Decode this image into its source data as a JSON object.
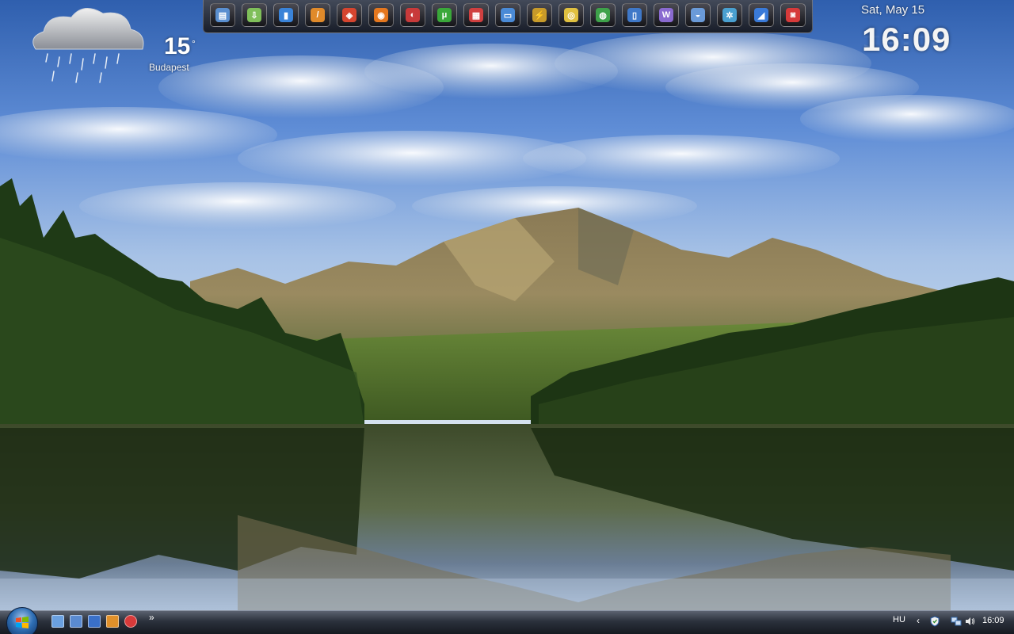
{
  "weather": {
    "temperature": "15",
    "unit": "°",
    "city": "Budapest",
    "condition_icon": "rain-cloud-icon"
  },
  "dock": {
    "icons": [
      {
        "name": "computer-icon",
        "glyph": "▤",
        "color": "#5a8fd0"
      },
      {
        "name": "downloader-icon",
        "glyph": "⇩",
        "color": "#7fbf5a"
      },
      {
        "name": "blue-app-icon",
        "glyph": "▮",
        "color": "#3a83d8"
      },
      {
        "name": "flash-tool-icon",
        "glyph": "/",
        "color": "#e08a2a"
      },
      {
        "name": "photo-app-icon",
        "glyph": "◈",
        "color": "#d6452f"
      },
      {
        "name": "firefox-icon",
        "glyph": "◉",
        "color": "#e5771e"
      },
      {
        "name": "security-app-icon",
        "glyph": "◐",
        "color": "#c83a3a"
      },
      {
        "name": "utorrent-icon",
        "glyph": "μ",
        "color": "#3aa83a"
      },
      {
        "name": "calendar-icon",
        "glyph": "▦",
        "color": "#d04040"
      },
      {
        "name": "window-app-icon",
        "glyph": "▭",
        "color": "#4a8ad6"
      },
      {
        "name": "winamp-icon",
        "glyph": "⚡",
        "color": "#c79a2a"
      },
      {
        "name": "disc-burner-icon",
        "glyph": "◎",
        "color": "#e0c040"
      },
      {
        "name": "chrome-icon",
        "glyph": "◍",
        "color": "#3ea24a"
      },
      {
        "name": "phone-icon",
        "glyph": "▯",
        "color": "#3f78c8"
      },
      {
        "name": "wiki-icon",
        "glyph": "W",
        "color": "#8a6ad0"
      },
      {
        "name": "disc-drive-icon",
        "glyph": "◒",
        "color": "#6a9ad8"
      },
      {
        "name": "settings-gears-icon",
        "glyph": "✲",
        "color": "#4aa0d0"
      },
      {
        "name": "satellite-icon",
        "glyph": "◢",
        "color": "#3a7ad8"
      },
      {
        "name": "robot-icon",
        "glyph": "◙",
        "color": "#d63a3a"
      }
    ]
  },
  "clock": {
    "date": "Sat, May 15",
    "time": "16:09"
  },
  "taskbar": {
    "start_label": "Start",
    "quick_launch": [
      {
        "name": "show-desktop-icon",
        "color": "#6aa0e0"
      },
      {
        "name": "switch-windows-icon",
        "color": "#5a8ad0"
      },
      {
        "name": "save-disk-icon",
        "color": "#3a70c8"
      },
      {
        "name": "orange-app-icon",
        "color": "#e0902a"
      },
      {
        "name": "opera-icon",
        "color": "#d83a3a"
      }
    ],
    "more_label": "»",
    "language": "HU",
    "chevron": "‹",
    "tray_time": "16:09"
  }
}
